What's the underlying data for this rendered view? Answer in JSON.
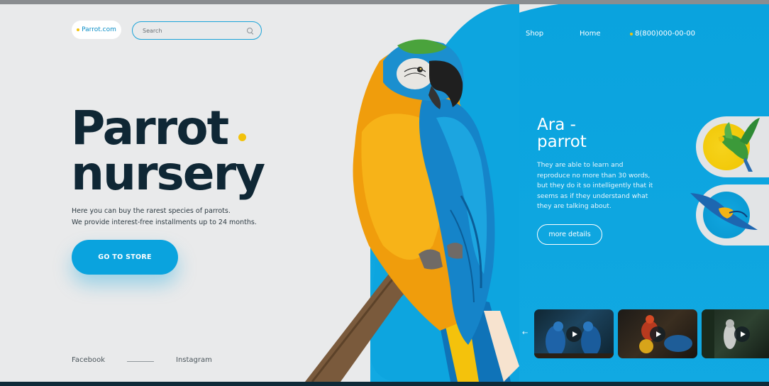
{
  "header": {
    "logo_text": "Parrot.com",
    "search_placeholder": "Search",
    "nav": [
      {
        "label": "Shop"
      },
      {
        "label": "Home"
      }
    ],
    "phone": "8(800)000-00-00"
  },
  "hero": {
    "title_line1": "Parrot",
    "title_line2": "nursery",
    "desc_line1": "Here you can buy the rarest species of parrots.",
    "desc_line2": "We provide interest-free installments up to 24 months.",
    "cta_label": "GO TO STORE"
  },
  "social": {
    "facebook": "Facebook",
    "instagram": "Instagram"
  },
  "info": {
    "title_line1": "Ara -",
    "title_line2": "parrot",
    "text": "They are able to learn and reproduce no more than 30 words, but they do it so intelligently that it seems as if they understand what they are talking about.",
    "more_label": "more details"
  },
  "videos": {
    "prev_arrow": "←",
    "items": [
      {
        "icon": "play-icon"
      },
      {
        "icon": "play-icon"
      },
      {
        "icon": "play-icon"
      }
    ]
  },
  "colors": {
    "accent": "#0aa3de",
    "dark": "#0f2735",
    "yellow": "#f2c20b",
    "background": "#e9eaeb"
  }
}
